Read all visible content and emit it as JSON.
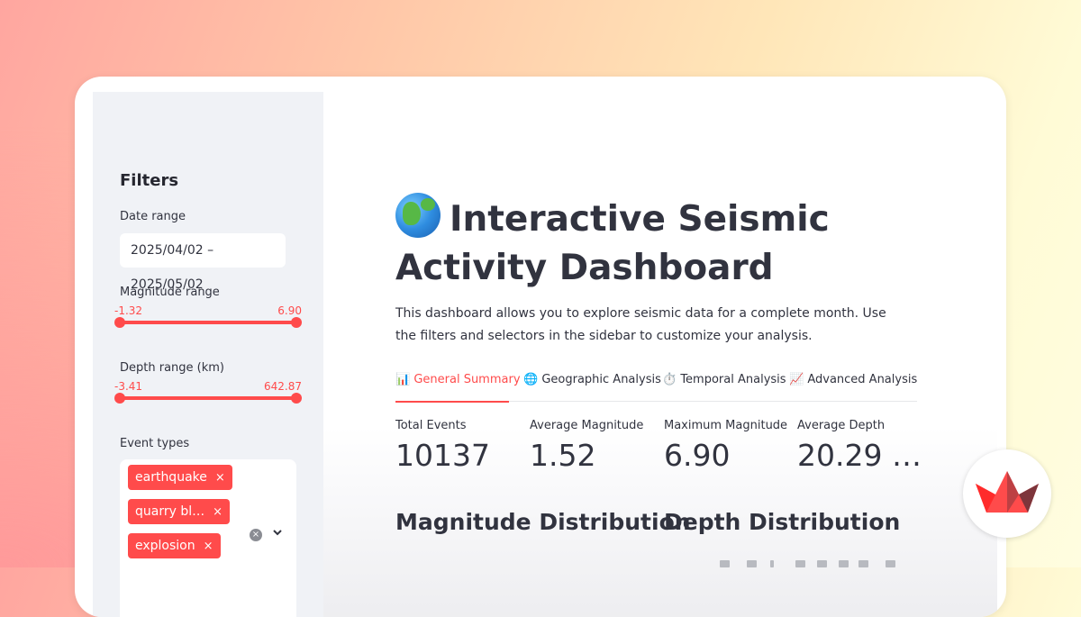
{
  "sidebar": {
    "title": "Filters",
    "date_range": {
      "label": "Date range",
      "value": "2025/04/02 – 2025/05/02"
    },
    "magnitude_range": {
      "label": "Magnitude range",
      "min": "-1.32",
      "max": "6.90"
    },
    "depth_range": {
      "label": "Depth range (km)",
      "min": "-3.41",
      "max": "642.87"
    },
    "event_types": {
      "label": "Event types",
      "tags": [
        {
          "label": "earthquake",
          "remove": "×"
        },
        {
          "label": "quarry bl…",
          "remove": "×"
        },
        {
          "label": "explosion",
          "remove": "×"
        }
      ],
      "clear_icon": "×",
      "dropdown_icon": "⌄"
    }
  },
  "main": {
    "title_icon": "globe-icon",
    "title": "Interactive Seismic Activity Dashboard",
    "description": "This dashboard allows you to explore seismic data for a complete month. Use the filters and selectors in the sidebar to customize your analysis.",
    "tabs": [
      {
        "icon": "📊",
        "label": "General Summary",
        "active": true
      },
      {
        "icon": "🌐",
        "label": "Geographic Analysis",
        "active": false
      },
      {
        "icon": "⏱️",
        "label": "Temporal Analysis",
        "active": false
      },
      {
        "icon": "📈",
        "label": "Advanced Analysis",
        "active": false
      }
    ],
    "metrics": [
      {
        "label": "Total Events",
        "value": "10137"
      },
      {
        "label": "Average Magnitude",
        "value": "1.52"
      },
      {
        "label": "Maximum Magnitude",
        "value": "6.90"
      },
      {
        "label": "Average Depth",
        "value": "20.29 …"
      }
    ],
    "sections": [
      "Magnitude Distribution",
      "Depth Distribution"
    ]
  },
  "colors": {
    "accent": "#ff4b4b",
    "sidebar_bg": "#f0f2f6",
    "text": "#31333f"
  },
  "badge_icon": "streamlit-logo-icon"
}
